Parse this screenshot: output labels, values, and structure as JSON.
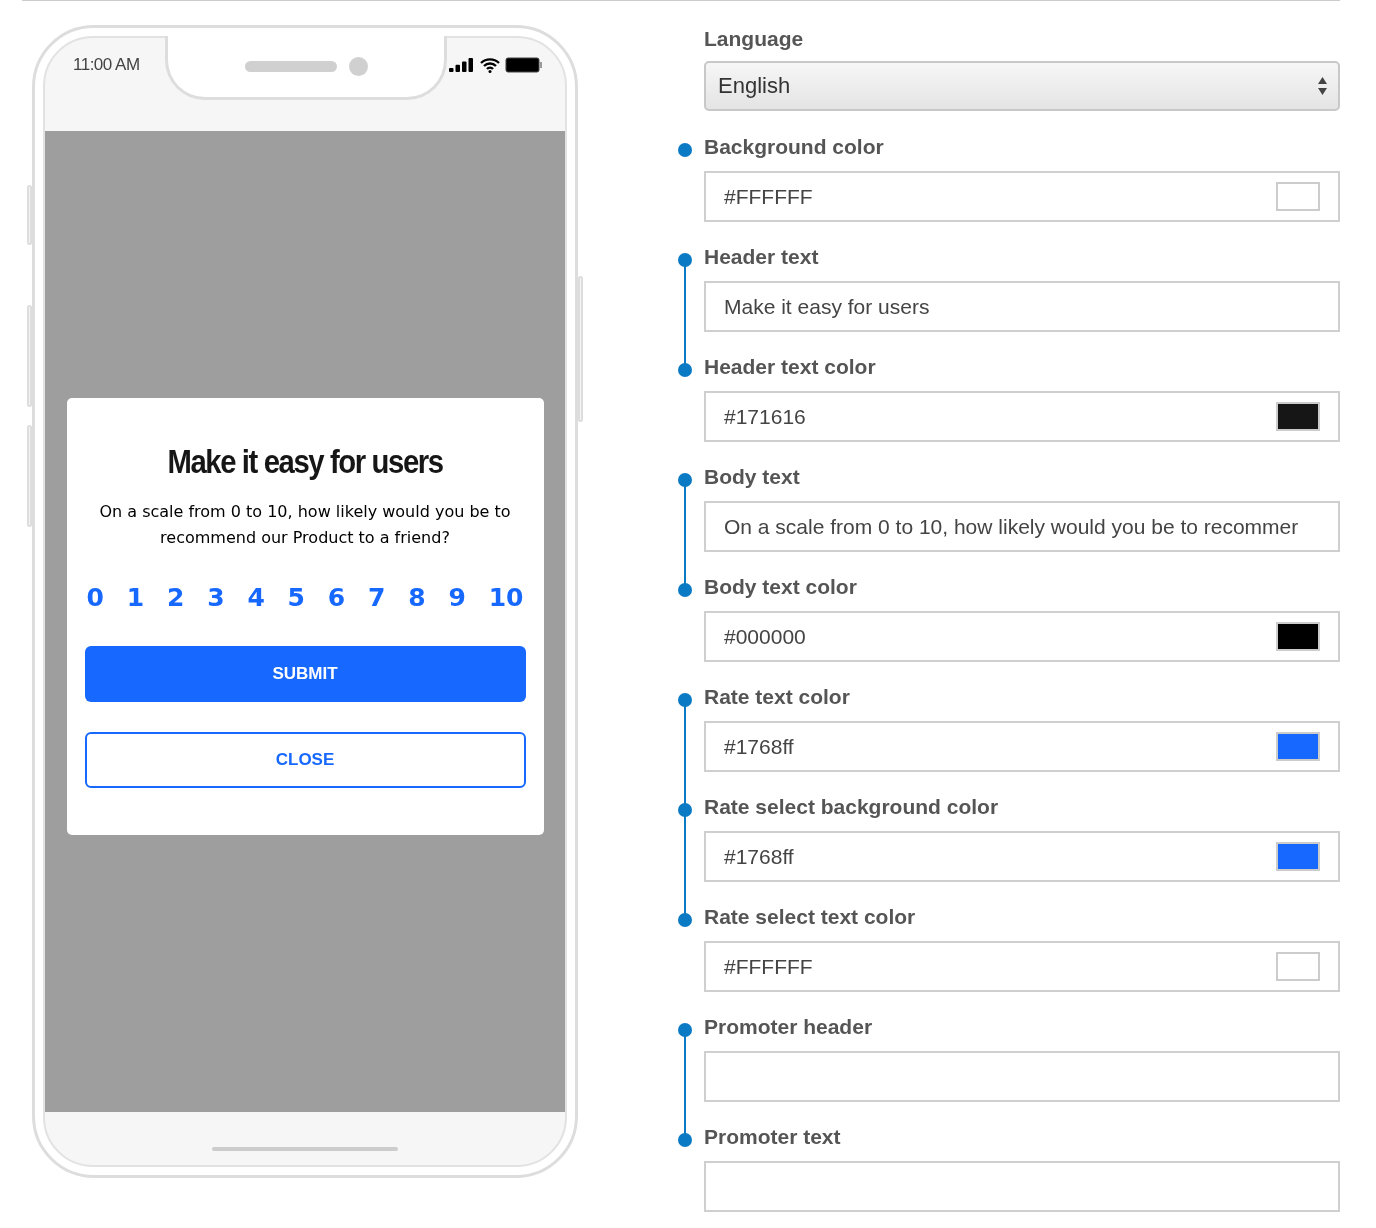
{
  "phone": {
    "status_time": "11:00 AM",
    "modal": {
      "title": "Make it easy for users",
      "body": "On a scale from 0 to 10, how likely would you be to recommend our Product to a friend?",
      "rates": [
        {
          "label": "0",
          "selected": false
        },
        {
          "label": "1",
          "selected": false
        },
        {
          "label": "2",
          "selected": false
        },
        {
          "label": "3",
          "selected": false
        },
        {
          "label": "4",
          "selected": false
        },
        {
          "label": "5",
          "selected": false
        },
        {
          "label": "6",
          "selected": false
        },
        {
          "label": "7",
          "selected": false
        },
        {
          "label": "8",
          "selected": false
        },
        {
          "label": "9",
          "selected": false
        },
        {
          "label": "10",
          "selected": false
        }
      ],
      "submit": "SUBMIT",
      "close": "CLOSE"
    }
  },
  "settings": {
    "language": {
      "label": "Language",
      "value": "English"
    },
    "groups": [
      {
        "fields": [
          {
            "kind": "color",
            "label": "Background color",
            "value": "#FFFFFF",
            "color": "#ffffff"
          }
        ]
      },
      {
        "fields": [
          {
            "kind": "text",
            "label": "Header text",
            "value": "Make it easy for users"
          },
          {
            "kind": "color",
            "label": "Header text color",
            "value": "#171616",
            "color": "#171616"
          }
        ]
      },
      {
        "fields": [
          {
            "kind": "text",
            "label": "Body text",
            "value": "On a scale from 0 to 10, how likely would you be to recommer"
          },
          {
            "kind": "color",
            "label": "Body text color",
            "value": "#000000",
            "color": "#000000"
          }
        ]
      },
      {
        "fields": [
          {
            "kind": "color",
            "label": "Rate text color",
            "value": "#1768ff",
            "color": "#1768ff"
          },
          {
            "kind": "color",
            "label": "Rate select background color",
            "value": "#1768ff",
            "color": "#1768ff"
          },
          {
            "kind": "color",
            "label": "Rate select text color",
            "value": "#FFFFFF",
            "color": "#ffffff"
          }
        ]
      },
      {
        "fields": [
          {
            "kind": "text",
            "label": "Promoter header"
          },
          {
            "kind": "text",
            "label": "Promoter text"
          }
        ]
      }
    ]
  }
}
